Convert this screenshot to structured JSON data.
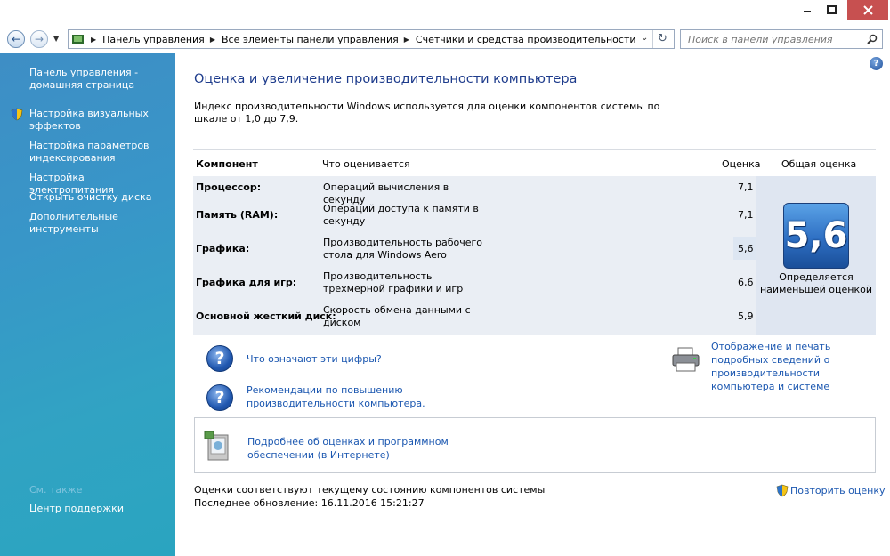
{
  "window": {
    "min_icon": "minimize-icon",
    "max_icon": "maximize-icon",
    "close_icon": "close-icon"
  },
  "nav": {
    "back_icon": "back-arrow-icon",
    "forward_icon": "forward-arrow-icon",
    "breadcrumbs": [
      "Панель управления",
      "Все элементы панели управления",
      "Счетчики и средства производительности"
    ],
    "search_placeholder": "Поиск в панели управления"
  },
  "sidebar": {
    "home": "Панель управления - домашняя страница",
    "links": [
      "Настройка визуальных эффектов",
      "Настройка параметров индексирования",
      "Настройка электропитания",
      "Открыть очистку диска",
      "Дополнительные инструменты"
    ],
    "see_also": "См. также",
    "support": "Центр поддержки"
  },
  "main": {
    "title": "Оценка и увеличение производительности компьютера",
    "description": "Индекс производительности Windows используется для оценки компонентов системы по шкале от 1,0 до 7,9.",
    "table": {
      "headers": {
        "component": "Компонент",
        "what": "Что оценивается",
        "score": "Оценка",
        "total": "Общая оценка"
      },
      "rows": [
        {
          "component": "Процессор:",
          "what": "Операций вычисления в секунду",
          "score": "7,1"
        },
        {
          "component": "Память (RAM):",
          "what": "Операций доступа к памяти в секунду",
          "score": "7,1"
        },
        {
          "component": "Графика:",
          "what": "Производительность рабочего стола для Windows Aero",
          "score": "5,6"
        },
        {
          "component": "Графика для игр:",
          "what": "Производительность трехмерной графики и игр",
          "score": "6,6"
        },
        {
          "component": "Основной жесткий диск:",
          "what": "Скорость обмена данными с диском",
          "score": "5,9"
        }
      ],
      "base_score": "5,6",
      "base_score_note": "Определяется наименьшей оценкой"
    },
    "links": {
      "what_numbers": "Что означают эти цифры?",
      "tips": "Рекомендации по повышению производительности компьютера.",
      "print_details": "Отображение и печать подробных сведений о производительности компьютера и системе",
      "online_more": "Подробнее об оценках и программном обеспечении (в Интернете)"
    },
    "footer": {
      "status": "Оценки соответствуют текущему состоянию компонентов системы",
      "last_update": "Последнее обновление: 16.11.2016 15:21:27",
      "rerun": "Повторить оценку"
    }
  }
}
